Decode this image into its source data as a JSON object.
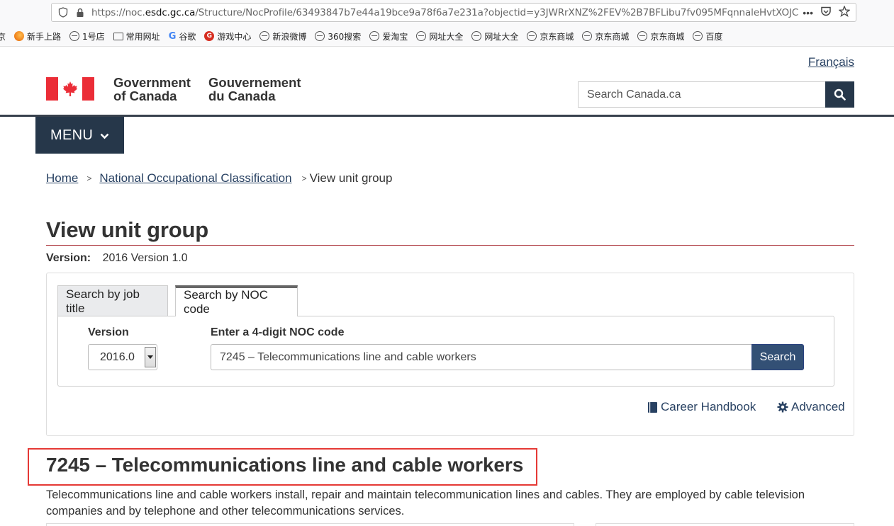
{
  "browser": {
    "url_prefix": "https://noc.",
    "url_domain": "esdc.gc.ca",
    "url_path": "/Structure/NocProfile/63493847b7e44a19bce9a78f6a7e231a?objectid=y3JWRrXNZ%2FEV%2B7BFLibu7fv095MFqnnaleHvtXOJC",
    "more_glyph": "•••",
    "bookmarks": [
      {
        "label": "京",
        "icon": "none"
      },
      {
        "label": "新手上路",
        "icon": "firefox-icon"
      },
      {
        "label": "1号店",
        "icon": "globe-icon"
      },
      {
        "label": "常用网址",
        "icon": "folder-icon"
      },
      {
        "label": "谷歌",
        "icon": "google-icon"
      },
      {
        "label": "游戏中心",
        "icon": "game-icon"
      },
      {
        "label": "新浪微博",
        "icon": "globe-icon"
      },
      {
        "label": "360搜索",
        "icon": "globe-icon"
      },
      {
        "label": "爱淘宝",
        "icon": "globe-icon"
      },
      {
        "label": "网址大全",
        "icon": "globe-icon"
      },
      {
        "label": "网址大全",
        "icon": "globe-icon"
      },
      {
        "label": "京东商城",
        "icon": "globe-icon"
      },
      {
        "label": "京东商城",
        "icon": "globe-icon"
      },
      {
        "label": "京东商城",
        "icon": "globe-icon"
      },
      {
        "label": "百度",
        "icon": "globe-icon"
      }
    ]
  },
  "header": {
    "language_link": "Français",
    "signature_en_line1": "Government",
    "signature_en_line2": "of Canada",
    "signature_fr_line1": "Gouvernement",
    "signature_fr_line2": "du Canada",
    "search_placeholder": "Search Canada.ca",
    "menu_label": "MENU"
  },
  "breadcrumb": {
    "home": "Home",
    "noc": "National Occupational Classification",
    "current": "View unit group",
    "separator": ">"
  },
  "page": {
    "title": "View unit group",
    "version_label": "Version:",
    "version_value": "2016 Version 1.0"
  },
  "search_panel": {
    "tabs": [
      "Search by job title",
      "Search by NOC code"
    ],
    "active_tab": "Search by NOC code",
    "version_label": "Version",
    "version_selected": "2016.0",
    "noc_label": "Enter a 4-digit NOC code",
    "noc_value": "7245 – Telecommunications line and cable workers",
    "search_button": "Search",
    "career_handbook": "Career Handbook",
    "advanced": "Advanced"
  },
  "result": {
    "heading": "7245 – Telecommunications line and cable workers",
    "description": "Telecommunications line and cable workers install, repair and maintain telecommunication lines and cables. They are employed by cable television companies and by telephone and other telecommunications services."
  },
  "colors": {
    "gc_blue": "#26374a",
    "link": "#284162",
    "flag_red": "#eb2d37",
    "title_rule": "#af3c43",
    "highlight": "#e53935"
  }
}
